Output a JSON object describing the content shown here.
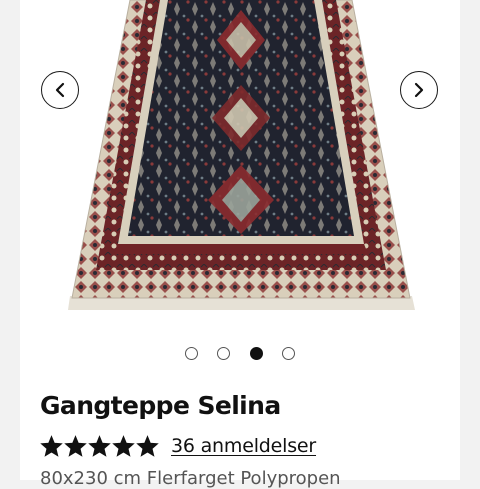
{
  "gallery": {
    "image_alt": "Gangteppe Selina",
    "prev_label": "‹",
    "next_label": "›",
    "dots_count": 4,
    "active_index": 2
  },
  "product": {
    "title": "Gangteppe Selina",
    "rating": 5,
    "rating_max": 5,
    "reviews_text": "36 anmeldelser",
    "subtitle": "80x230 cm Flerfarget Polypropen"
  },
  "colors": {
    "page_bg": "#f2f2f2",
    "card_bg": "#ffffff",
    "text": "#111111",
    "rug_field": "#1f2230",
    "rug_red": "#7a2a2a",
    "rug_cream": "#ddd5c2"
  }
}
